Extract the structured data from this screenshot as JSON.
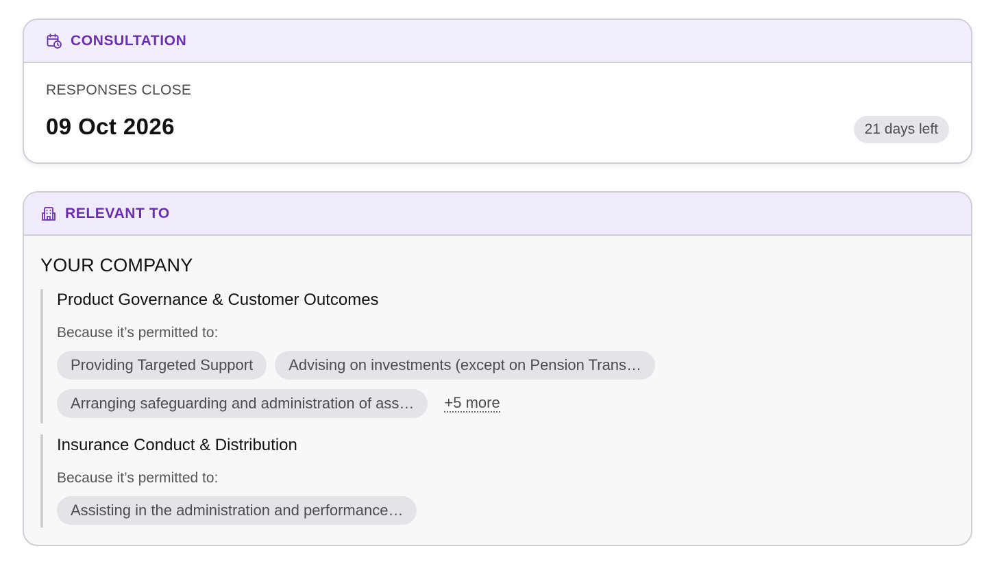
{
  "consultation": {
    "header": "CONSULTATION",
    "icon": "calendar-clock-icon",
    "responses_label": "RESPONSES CLOSE",
    "close_date": "09 Oct 2026",
    "days_left": "21 days left"
  },
  "relevant": {
    "header": "RELEVANT TO",
    "icon": "building-icon",
    "company_label": "YOUR COMPANY",
    "groups": [
      {
        "title": "Product Governance & Customer Outcomes",
        "because": "Because it’s permitted to:",
        "chips": [
          "Providing Targeted Support",
          "Advising on investments (except on Pension Trans…",
          "Arranging safeguarding and administration of ass…"
        ],
        "more": "+5 more"
      },
      {
        "title": "Insurance Conduct & Distribution",
        "because": "Because it’s permitted to:",
        "chips": [
          "Assisting in the administration and performance…"
        ]
      }
    ]
  },
  "colors": {
    "accent": "#6a2fb0",
    "header_bg": "#f3eefd",
    "chip_bg": "#e4e3e8",
    "border": "#cfcdd6"
  }
}
